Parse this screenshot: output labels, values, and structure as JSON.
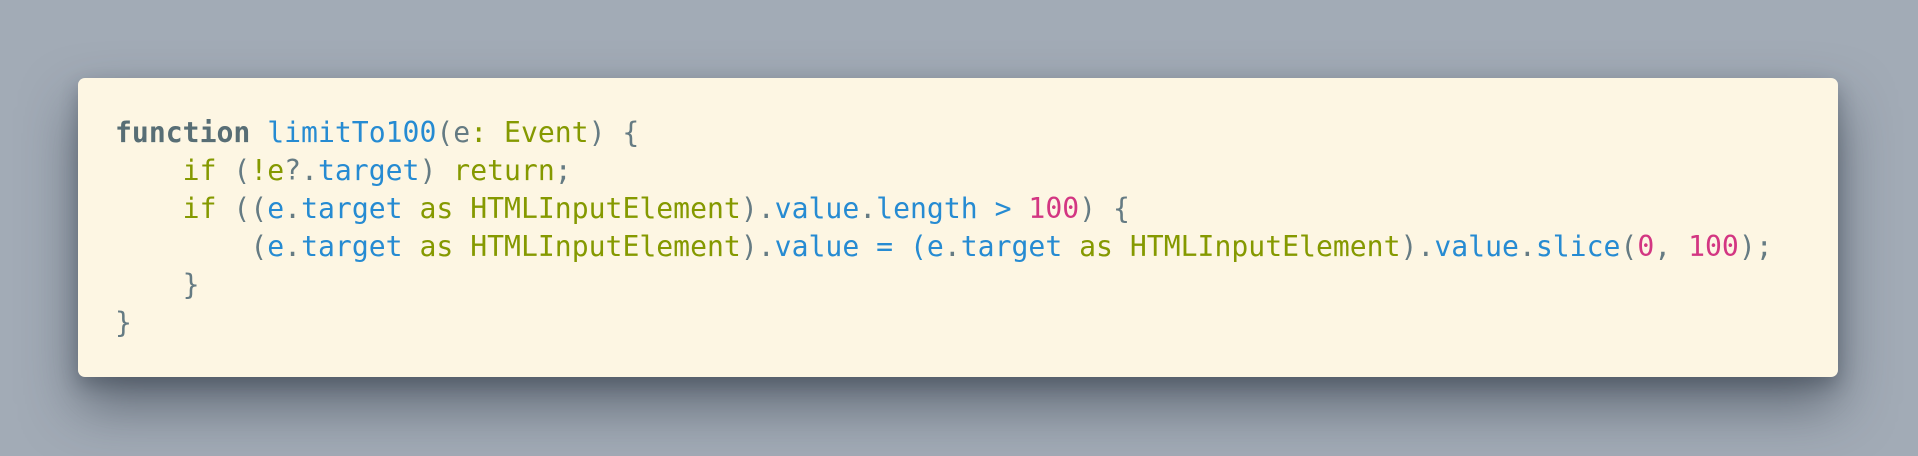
{
  "colors": {
    "background": "#a2abb6",
    "card_background": "#fdf6e3",
    "plain_text": "#657b83",
    "keyword": "#586e75",
    "function_name": "#268bd2",
    "type_and_control": "#859900",
    "property": "#268bd2",
    "number": "#d33682"
  },
  "code": {
    "language": "typescript",
    "lines": [
      {
        "indent": "",
        "tokens": [
          {
            "text": "function",
            "kind": "keyword"
          },
          {
            "text": " ",
            "kind": "plain"
          },
          {
            "text": "limitTo100",
            "kind": "function"
          },
          {
            "text": "(e",
            "kind": "plain"
          },
          {
            "text": ": Event",
            "kind": "type"
          },
          {
            "text": ") {",
            "kind": "plain"
          }
        ]
      },
      {
        "indent": "    ",
        "tokens": [
          {
            "text": "if",
            "kind": "control"
          },
          {
            "text": " (",
            "kind": "plain"
          },
          {
            "text": "!e",
            "kind": "control"
          },
          {
            "text": "?.",
            "kind": "plain"
          },
          {
            "text": "target",
            "kind": "property"
          },
          {
            "text": ") ",
            "kind": "plain"
          },
          {
            "text": "return",
            "kind": "control"
          },
          {
            "text": ";",
            "kind": "plain"
          }
        ]
      },
      {
        "indent": "    ",
        "tokens": [
          {
            "text": "if",
            "kind": "control"
          },
          {
            "text": " ((",
            "kind": "plain"
          },
          {
            "text": "e",
            "kind": "property"
          },
          {
            "text": ".",
            "kind": "plain"
          },
          {
            "text": "target",
            "kind": "property"
          },
          {
            "text": " as HTMLInputElement",
            "kind": "type"
          },
          {
            "text": ").",
            "kind": "plain"
          },
          {
            "text": "value",
            "kind": "property"
          },
          {
            "text": ".",
            "kind": "plain"
          },
          {
            "text": "length",
            "kind": "property"
          },
          {
            "text": " > ",
            "kind": "property"
          },
          {
            "text": "100",
            "kind": "number"
          },
          {
            "text": ") {",
            "kind": "plain"
          }
        ]
      },
      {
        "indent": "        ",
        "tokens": [
          {
            "text": "(",
            "kind": "plain"
          },
          {
            "text": "e",
            "kind": "property"
          },
          {
            "text": ".",
            "kind": "plain"
          },
          {
            "text": "target",
            "kind": "property"
          },
          {
            "text": " as HTMLInputElement",
            "kind": "type"
          },
          {
            "text": ").",
            "kind": "plain"
          },
          {
            "text": "value",
            "kind": "property"
          },
          {
            "text": " = (",
            "kind": "property"
          },
          {
            "text": "e",
            "kind": "property"
          },
          {
            "text": ".",
            "kind": "plain"
          },
          {
            "text": "target",
            "kind": "property"
          },
          {
            "text": " as HTMLInputElement",
            "kind": "type"
          },
          {
            "text": ").",
            "kind": "plain"
          },
          {
            "text": "value",
            "kind": "property"
          },
          {
            "text": ".",
            "kind": "plain"
          },
          {
            "text": "slice",
            "kind": "property"
          },
          {
            "text": "(",
            "kind": "plain"
          },
          {
            "text": "0",
            "kind": "number"
          },
          {
            "text": ", ",
            "kind": "plain"
          },
          {
            "text": "100",
            "kind": "number"
          },
          {
            "text": ");",
            "kind": "plain"
          }
        ]
      },
      {
        "indent": "   ",
        "tokens": [
          {
            "text": " }",
            "kind": "plain"
          }
        ]
      },
      {
        "indent": "",
        "tokens": [
          {
            "text": "}",
            "kind": "plain"
          }
        ]
      }
    ]
  }
}
